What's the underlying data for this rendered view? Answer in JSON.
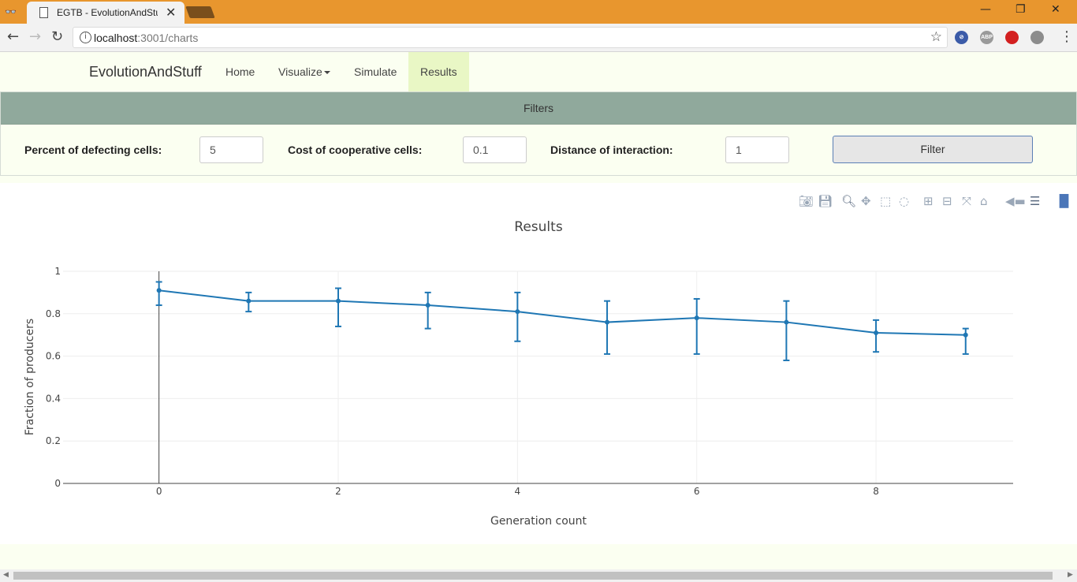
{
  "browser": {
    "tab_title": "EGTB - EvolutionAndStuff",
    "url_host": "localhost",
    "url_rest": ":3001/charts",
    "extensions": [
      "ABP"
    ]
  },
  "navbar": {
    "brand": "EvolutionAndStuff",
    "items": [
      {
        "label": "Home"
      },
      {
        "label": "Visualize"
      },
      {
        "label": "Simulate"
      },
      {
        "label": "Results",
        "active": true
      }
    ]
  },
  "filters": {
    "title": "Filters",
    "fields": [
      {
        "label": "Percent of defecting cells:",
        "value": "5"
      },
      {
        "label": "Cost of cooperative cells:",
        "value": "0.1"
      },
      {
        "label": "Distance of interaction:",
        "value": "1"
      }
    ],
    "button_label": "Filter"
  },
  "colors": {
    "series": "#1f77b4",
    "accent_active": "#e9f7c5",
    "filters_header": "#90a99c"
  },
  "chart_data": {
    "type": "line",
    "title": "Results",
    "xlabel": "Generation count",
    "ylabel": "Fraction of producers",
    "x": [
      0,
      1,
      2,
      3,
      4,
      5,
      6,
      7,
      8,
      9
    ],
    "series": [
      {
        "values": [
          0.91,
          0.86,
          0.86,
          0.84,
          0.81,
          0.76,
          0.78,
          0.76,
          0.71,
          0.7
        ],
        "error_upper": [
          0.95,
          0.9,
          0.92,
          0.9,
          0.9,
          0.86,
          0.87,
          0.86,
          0.77,
          0.73
        ],
        "error_lower": [
          0.84,
          0.81,
          0.74,
          0.73,
          0.67,
          0.61,
          0.61,
          0.58,
          0.62,
          0.61
        ]
      }
    ],
    "xlim": [
      -1.07,
      9.53
    ],
    "ylim": [
      0,
      1
    ],
    "xticks": [
      "0",
      "2",
      "4",
      "6",
      "8"
    ],
    "xtick_values": [
      0,
      2,
      4,
      6,
      8
    ],
    "yticks": [
      "0",
      "0.2",
      "0.4",
      "0.6",
      "0.8",
      "1"
    ],
    "ytick_values": [
      0,
      0.2,
      0.4,
      0.6,
      0.8,
      1
    ],
    "grid": true
  }
}
